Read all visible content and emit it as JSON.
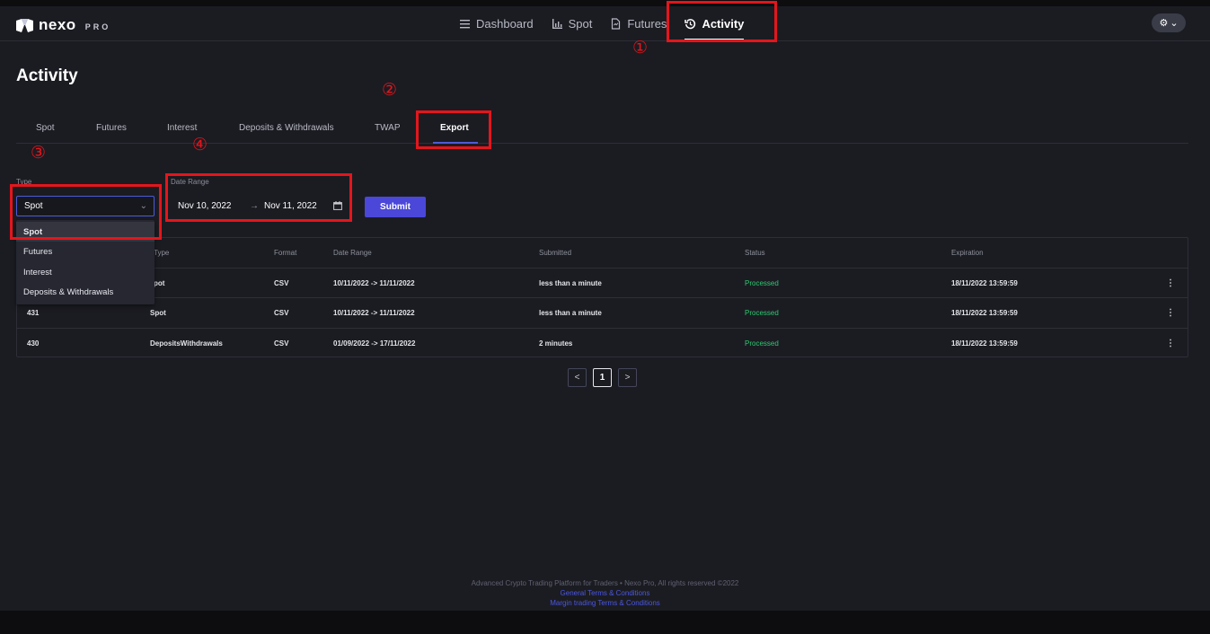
{
  "brand": {
    "name": "nexo",
    "suffix": "PRO"
  },
  "nav": {
    "items": [
      {
        "label": "Dashboard",
        "icon": "menu-lines-icon"
      },
      {
        "label": "Spot",
        "icon": "chart-icon"
      },
      {
        "label": "Futures",
        "icon": "document-icon"
      },
      {
        "label": "Activity",
        "icon": "history-icon"
      }
    ]
  },
  "page": {
    "title": "Activity"
  },
  "tabs": [
    "Spot",
    "Futures",
    "Interest",
    "Deposits & Withdrawals",
    "TWAP",
    "Export"
  ],
  "form": {
    "type_label": "Type",
    "type_value": "Spot",
    "type_options": [
      "Spot",
      "Futures",
      "Interest",
      "Deposits & Withdrawals"
    ],
    "date_label": "Date Range",
    "date_from": "Nov 10, 2022",
    "date_to": "Nov 11, 2022",
    "submit_label": "Submit"
  },
  "table": {
    "headers": [
      "Type",
      "Format",
      "Date Range",
      "Submitted",
      "Status",
      "Expiration"
    ],
    "rows": [
      {
        "id": "",
        "type": "pot",
        "format": "CSV",
        "range": "10/11/2022 -> 11/11/2022",
        "submitted": "less than a minute",
        "status": "Processed",
        "expiration": "18/11/2022 13:59:59"
      },
      {
        "id": "431",
        "type": "Spot",
        "format": "CSV",
        "range": "10/11/2022 -> 11/11/2022",
        "submitted": "less than a minute",
        "status": "Processed",
        "expiration": "18/11/2022 13:59:59"
      },
      {
        "id": "430",
        "type": "DepositsWithdrawals",
        "format": "CSV",
        "range": "01/09/2022 -> 17/11/2022",
        "submitted": "2 minutes",
        "status": "Processed",
        "expiration": "18/11/2022 13:59:59"
      }
    ]
  },
  "pagination": {
    "prev": "<",
    "current": "1",
    "next": ">"
  },
  "footer": {
    "text": "Advanced Crypto Trading Platform for Traders • Nexo Pro, All rights reserved ©2022",
    "links": [
      "General Terms & Conditions",
      "Margin trading Terms & Conditions"
    ]
  },
  "annotations": [
    "①",
    "②",
    "③",
    "④"
  ],
  "colors": {
    "accent": "#4a47d9",
    "success": "#2fc870",
    "highlight": "#e3161c",
    "background": "#1b1c22"
  }
}
